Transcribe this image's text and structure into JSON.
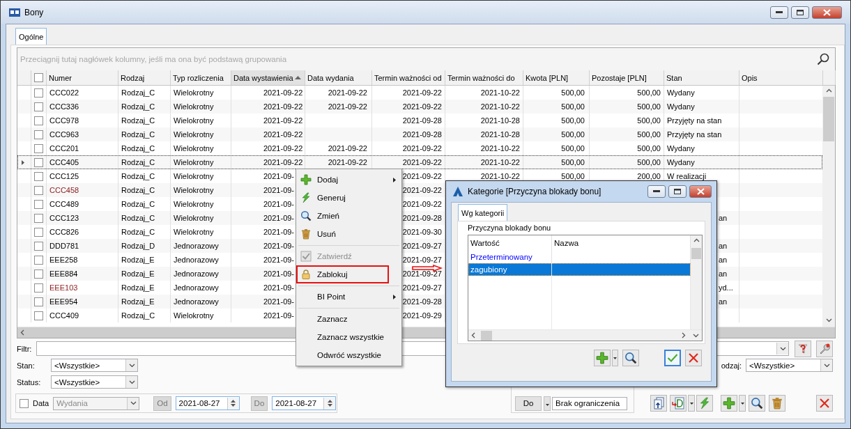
{
  "window": {
    "title": "Bony"
  },
  "tabs": [
    {
      "label": "Ogólne",
      "selected": true
    }
  ],
  "grid": {
    "group_hint": "Przeciągnij tutaj nagłówek kolumny, jeśli ma ona być podstawą grupowania",
    "select_all_checked": false,
    "columns": [
      {
        "label": "Numer",
        "sorted": false
      },
      {
        "label": "Rodzaj",
        "sorted": false
      },
      {
        "label": "Typ rozliczenia",
        "sorted": false
      },
      {
        "label": "Data wystawienia",
        "sorted": true
      },
      {
        "label": "Data wydania",
        "sorted": false
      },
      {
        "label": "Termin ważności od",
        "sorted": false
      },
      {
        "label": "Termin ważności do",
        "sorted": false
      },
      {
        "label": "Kwota [PLN]",
        "sorted": false
      },
      {
        "label": "Pozostaje [PLN]",
        "sorted": false
      },
      {
        "label": "Stan",
        "sorted": false
      },
      {
        "label": "Opis",
        "sorted": false
      }
    ],
    "rows": [
      {
        "selected": false,
        "checked": false,
        "numer": "CCC022",
        "rodzaj": "Rodzaj_C",
        "typ": "Wielokrotny",
        "data_wystawienia": "2021-09-22",
        "data_wydania": "2021-09-22",
        "termin_od": "2021-09-22",
        "termin_do": "2021-10-22",
        "kwota": "500,00",
        "pozostaje": "500,00",
        "stan": "Wydany"
      },
      {
        "selected": false,
        "checked": false,
        "numer": "CCC336",
        "rodzaj": "Rodzaj_C",
        "typ": "Wielokrotny",
        "data_wystawienia": "2021-09-22",
        "data_wydania": "2021-09-22",
        "termin_od": "2021-09-22",
        "termin_do": "2021-10-22",
        "kwota": "500,00",
        "pozostaje": "500,00",
        "stan": "Wydany"
      },
      {
        "selected": false,
        "checked": false,
        "numer": "CCC978",
        "rodzaj": "Rodzaj_C",
        "typ": "Wielokrotny",
        "data_wystawienia": "2021-09-22",
        "termin_od": "2021-09-28",
        "termin_do": "2021-10-28",
        "kwota": "500,00",
        "pozostaje": "500,00",
        "stan": "Przyjęty na stan"
      },
      {
        "selected": false,
        "checked": false,
        "numer": "CCC963",
        "rodzaj": "Rodzaj_C",
        "typ": "Wielokrotny",
        "data_wystawienia": "2021-09-22",
        "termin_od": "2021-09-28",
        "termin_do": "2021-10-28",
        "kwota": "500,00",
        "pozostaje": "500,00",
        "stan": "Przyjęty na stan"
      },
      {
        "selected": false,
        "checked": false,
        "numer": "CCC201",
        "rodzaj": "Rodzaj_C",
        "typ": "Wielokrotny",
        "data_wystawienia": "2021-09-22",
        "data_wydania": "2021-09-22",
        "termin_od": "2021-09-22",
        "termin_do": "2021-10-22",
        "kwota": "500,00",
        "pozostaje": "500,00",
        "stan": "Wydany"
      },
      {
        "selected": true,
        "checked": false,
        "numer": "CCC405",
        "rodzaj": "Rodzaj_C",
        "typ": "Wielokrotny",
        "data_wystawienia": "2021-09-22",
        "data_wydania": "2021-09-22",
        "termin_od": "2021-09-22",
        "termin_do": "2021-10-22",
        "kwota": "500,00",
        "pozostaje": "500,00",
        "stan": "Wydany"
      },
      {
        "selected": false,
        "checked": false,
        "numer": "CCC125",
        "rodzaj": "Rodzaj_C",
        "typ": "Wielokrotny",
        "data_wystawienia": "2021-09-",
        "termin_od": "2021-09-22",
        "termin_do": "2021-10-22",
        "kwota": "500,00",
        "pozostaje": "200,00",
        "stan": "W realizacji"
      },
      {
        "selected": false,
        "checked": false,
        "color": "#8b1a1a",
        "numer": "CCC458",
        "rodzaj": "Rodzaj_C",
        "typ": "Wielokrotny",
        "data_wystawienia": "2021-09-",
        "termin_od": "2021-09-22"
      },
      {
        "selected": false,
        "checked": false,
        "numer": "CCC489",
        "rodzaj": "Rodzaj_C",
        "typ": "Wielokrotny",
        "data_wystawienia": "2021-09-",
        "termin_od": "2021-09-22"
      },
      {
        "selected": false,
        "checked": false,
        "numer": "CCC123",
        "rodzaj": "Rodzaj_C",
        "typ": "Wielokrotny",
        "data_wystawienia": "2021-09-",
        "termin_od": "2021-09-28",
        "stan": "an",
        "stan_cut": true
      },
      {
        "selected": false,
        "checked": false,
        "numer": "CCC826",
        "rodzaj": "Rodzaj_C",
        "typ": "Wielokrotny",
        "data_wystawienia": "2021-09-",
        "termin_od": "2021-09-30"
      },
      {
        "selected": false,
        "checked": false,
        "numer": "DDD781",
        "rodzaj": "Rodzaj_D",
        "typ": "Jednorazowy",
        "data_wystawienia": "2021-09-",
        "termin_od": "2021-09-27",
        "stan": "an",
        "stan_cut": true
      },
      {
        "selected": false,
        "checked": false,
        "numer": "EEE258",
        "rodzaj": "Rodzaj_E",
        "typ": "Jednorazowy",
        "data_wystawienia": "2021-09-",
        "termin_od": "2021-09-27",
        "stan": "an",
        "stan_cut": true
      },
      {
        "selected": false,
        "checked": false,
        "numer": "EEE884",
        "rodzaj": "Rodzaj_E",
        "typ": "Jednorazowy",
        "data_wystawienia": "2021-09-",
        "termin_od": "2021-09-27",
        "stan": "an",
        "stan_cut": true
      },
      {
        "selected": false,
        "checked": false,
        "color": "#8b1a1a",
        "numer": "EEE103",
        "rodzaj": "Rodzaj_E",
        "typ": "Jednorazowy",
        "data_wystawienia": "2021-09-",
        "termin_od": "2021-09-27",
        "stan": "yd...",
        "stan_cut": true
      },
      {
        "selected": false,
        "checked": false,
        "numer": "EEE954",
        "rodzaj": "Rodzaj_E",
        "typ": "Jednorazowy",
        "data_wystawienia": "2021-09-",
        "termin_od": "2021-09-28",
        "stan": "an",
        "stan_cut": true
      },
      {
        "selected": false,
        "checked": false,
        "numer": "CCC409",
        "rodzaj": "Rodzaj_C",
        "typ": "Wielokrotny",
        "data_wystawienia": "2021-09-",
        "termin_od": "2021-09-29"
      }
    ]
  },
  "filters": {
    "filter_label": "Filtr:",
    "stan": {
      "label": "Stan:",
      "value": "<Wszystkie>"
    },
    "status": {
      "label": "Status:",
      "value": "<Wszystkie>"
    },
    "rodzaj": {
      "label": "odzaj:",
      "value": "<Wszystkie>"
    },
    "date": {
      "checked": false,
      "label": "Data",
      "type_value": "Wydania",
      "from_label": "Od",
      "from_value": "2021-08-27",
      "to_label": "Do",
      "to_value": "2021-08-27"
    },
    "range_to": {
      "label": "Do",
      "value": "Brak ograniczenia"
    }
  },
  "context_menu": {
    "items": [
      {
        "kind": "item",
        "label": "Dodaj",
        "submenu": true,
        "disabled": false,
        "highlighted": false
      },
      {
        "kind": "item",
        "label": "Generuj",
        "submenu": false,
        "disabled": false,
        "highlighted": false
      },
      {
        "kind": "item",
        "label": "Zmień",
        "submenu": false,
        "disabled": false,
        "highlighted": false
      },
      {
        "kind": "item",
        "label": "Usuń",
        "submenu": false,
        "disabled": false,
        "highlighted": false
      },
      {
        "kind": "separator"
      },
      {
        "kind": "item",
        "label": "Zatwierdź",
        "submenu": false,
        "disabled": true,
        "highlighted": false
      },
      {
        "kind": "item",
        "label": "Zablokuj",
        "submenu": false,
        "disabled": false,
        "highlighted": true
      },
      {
        "kind": "separator"
      },
      {
        "kind": "item",
        "label": "BI Point",
        "submenu": true,
        "disabled": false,
        "highlighted": false
      },
      {
        "kind": "separator"
      },
      {
        "kind": "item",
        "label": "Zaznacz",
        "submenu": false,
        "disabled": false,
        "highlighted": false
      },
      {
        "kind": "item",
        "label": "Zaznacz wszystkie",
        "submenu": false,
        "disabled": false,
        "highlighted": false
      },
      {
        "kind": "item",
        "label": "Odwróć wszystkie",
        "submenu": false,
        "disabled": false,
        "highlighted": false
      }
    ]
  },
  "dialog": {
    "title": "Kategorie [Przyczyna blokady bonu]",
    "tabs": [
      {
        "label": "Wg kategorii",
        "selected": true
      }
    ],
    "group_label": "Przyczyna blokady bonu",
    "columns": [
      {
        "label": "Wartość"
      },
      {
        "label": "Nazwa"
      }
    ],
    "rows": [
      {
        "value": "Przeterminowany",
        "selected": false,
        "color": "#0000ff"
      },
      {
        "value": "zagubiony",
        "selected": true
      }
    ]
  }
}
